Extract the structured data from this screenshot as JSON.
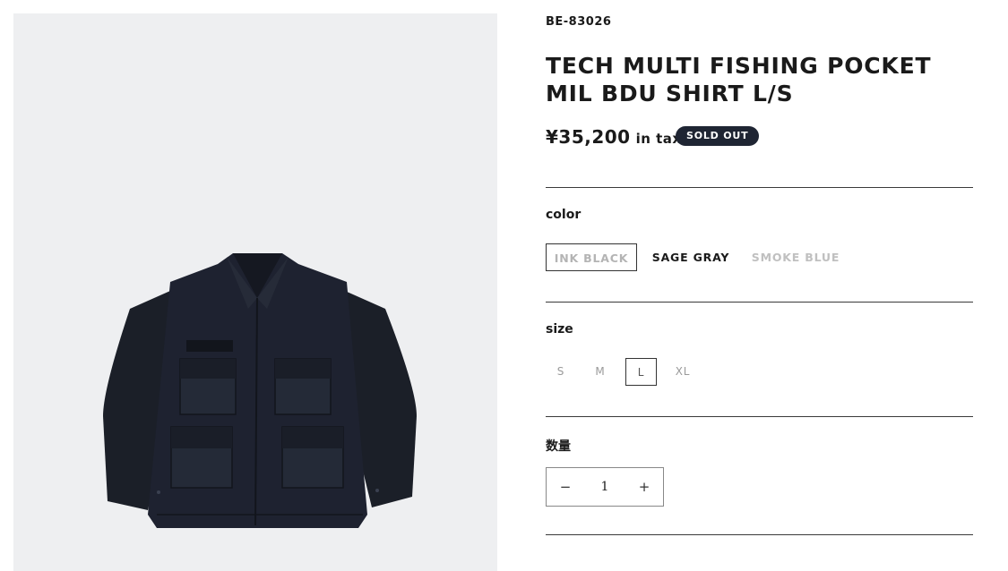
{
  "product": {
    "sku": "BE-83026",
    "title": "TECH MULTI FISHING POCKET MIL BDU SHIRT L/S",
    "price": "¥35,200",
    "tax_note": "in tax",
    "status_badge": "SOLD OUT"
  },
  "color": {
    "label": "color",
    "options": [
      {
        "label": "INK BLACK",
        "state": "selected"
      },
      {
        "label": "SAGE GRAY",
        "state": "available"
      },
      {
        "label": "SMOKE BLUE",
        "state": "unavailable"
      }
    ]
  },
  "size": {
    "label": "size",
    "options": [
      {
        "label": "S",
        "state": "default"
      },
      {
        "label": "M",
        "state": "default"
      },
      {
        "label": "L",
        "state": "selected"
      },
      {
        "label": "XL",
        "state": "default"
      }
    ]
  },
  "quantity": {
    "label": "数量",
    "value": "1",
    "decrement_symbol": "−",
    "increment_symbol": "+"
  },
  "colors": {
    "badge_bg": "#1f2533",
    "image_bg": "#eeeff1",
    "garment": "#1c2029"
  }
}
